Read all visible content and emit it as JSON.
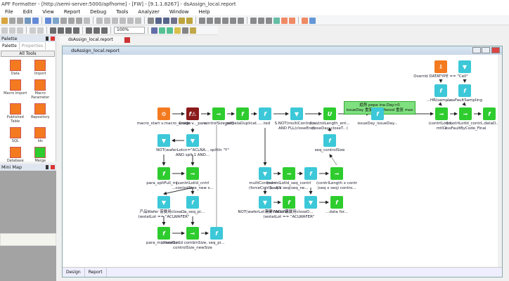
{
  "app": {
    "title": "APF Formatter - [http://semi-server:5000/apfhome] - [FW] - [9.1.1.8267] - dsAssign_local.report"
  },
  "menu": [
    "File",
    "Edit",
    "View",
    "Report",
    "Debug",
    "Tools",
    "Analyzer",
    "Window",
    "Help"
  ],
  "toolbar": {
    "zoom": "100%"
  },
  "palette": {
    "title": "Palette",
    "tabs": [
      "Palette",
      "Properties"
    ],
    "all_label": "All Tools",
    "items": [
      {
        "label": "Data",
        "color": "#f47a20"
      },
      {
        "label": "Import",
        "color": "#f47a20"
      },
      {
        "label": "Macro Import",
        "color": "#f47a20"
      },
      {
        "label": "Macro Parameter",
        "color": "#f47a20"
      },
      {
        "label": "Published Table",
        "color": "#f47a20"
      },
      {
        "label": "Repository",
        "color": "#f47a20"
      },
      {
        "label": "SQL",
        "color": "#f47a20"
      },
      {
        "label": "Ids",
        "color": "#f47a20"
      },
      {
        "label": "Database",
        "color": "#f47a20"
      },
      {
        "label": "Merge",
        "color": "#2ecc2e"
      }
    ]
  },
  "minimap": {
    "title": "Mini Map"
  },
  "document": {
    "tab": "dsAssign_local.report",
    "window_title": "dsAssign_local.report",
    "bottom_tabs": [
      "Design",
      "Report"
    ]
  },
  "note": {
    "lines": [
      "趋势 pepe ine.Day>0",
      "issueDay 重复 min, feood 重复 max"
    ]
  },
  "nodes": [
    {
      "type": "orange",
      "glyph": "⚙",
      "label": "macro_start v.macro_assign"
    },
    {
      "type": "red",
      "glyph": "f⚠",
      "label": "Credo v.._para"
    },
    {
      "type": "green",
      "glyph": "⊸",
      "label": "controlSize_seq"
    },
    {
      "type": "green",
      "glyph": "f",
      "label": "getDataDuplicat..."
    },
    {
      "type": "cyan",
      "glyph": "f",
      "label": "...ted"
    },
    {
      "type": "cyan",
      "glyph": "▼",
      "label": "S.NOT(multiControl>...\nAND FLL(closeEnd)"
    },
    {
      "type": "green",
      "glyph": "U",
      "label": "(controlLength_ent...\ncloseDay_closeT.. ("
    },
    {
      "type": "cyan",
      "glyph": "f",
      "label": "issueDay_issueDay..."
    },
    {
      "type": "green",
      "glyph": "⊸",
      "label": "(contrlLotId...\nmtlCl"
    },
    {
      "type": "green",
      "glyph": "⊸",
      "label": "(contrlLotId_contrl..\nessFaultByCode_Final"
    },
    {
      "type": "green",
      "glyph": "f",
      "label": "...dataD.."
    },
    {
      "type": "orange",
      "glyph": "⇩",
      "label": "Overrid DATATYPE == \"Cell\""
    },
    {
      "type": "cyan",
      "glyph": "▼",
      "label": ""
    },
    {
      "type": "cyan",
      "glyph": "f",
      "label": "...HR(sample..."
    },
    {
      "type": "cyan",
      "glyph": "f",
      "label": "...ssFaultSampling"
    },
    {
      "type": "cyan",
      "glyph": "▼",
      "label": "NOT(waferLotcn=\"ACLNA... spiltIn \"Y\"\nAND splt 1 AND..."
    },
    {
      "type": "cyan",
      "glyph": "▼",
      "label": ""
    },
    {
      "type": "cyan",
      "glyph": "f",
      "label": "seq_controlSize"
    },
    {
      "type": "green",
      "glyph": "f",
      "label": "para_spltFull_mj..."
    },
    {
      "type": "green",
      "glyph": "⊸",
      "label": "(contrlLotId_cntrl\n...controlSize_new s..."
    },
    {
      "type": "cyan",
      "glyph": "▼",
      "label": "multiControl> ...\n(forceCntrlS...AN"
    },
    {
      "type": "green",
      "glyph": "⊸",
      "label": "(contrlLotId_seq_contrl\n(seq x seq(seq_ne..."
    },
    {
      "type": "cyan",
      "glyph": "f",
      "label": ""
    },
    {
      "type": "green",
      "glyph": "⊸",
      "label": "(contrlLength x contr\n(seq x seq) contro..."
    },
    {
      "type": "cyan",
      "glyph": "▼",
      "label": "产品Wafer 需要用closeD...\n(wstatLot == \"ACLWAFER\""
    },
    {
      "type": "cyan",
      "glyph": "f",
      "label": "...e_seq_pi..."
    },
    {
      "type": "cyan",
      "glyph": "▼",
      "label": "NOT(waferLot == \"ACLWA...\n"
    },
    {
      "type": "green",
      "glyph": "f",
      "label": "需要Wafer 需要用closeD...\n(wstatLot == \"ACLWAFER\""
    },
    {
      "type": "cyan",
      "glyph": "▼",
      "label": ""
    },
    {
      "type": "green",
      "glyph": "f",
      "label": "...data for..."
    },
    {
      "type": "green",
      "glyph": "f",
      "label": "para_multiwaDe..."
    },
    {
      "type": "green",
      "glyph": "⊸",
      "label": "(contrlLotId combinSize, seq_pi...\ncontrolSize_newSize"
    },
    {
      "type": "cyan",
      "glyph": "f",
      "label": ""
    }
  ]
}
